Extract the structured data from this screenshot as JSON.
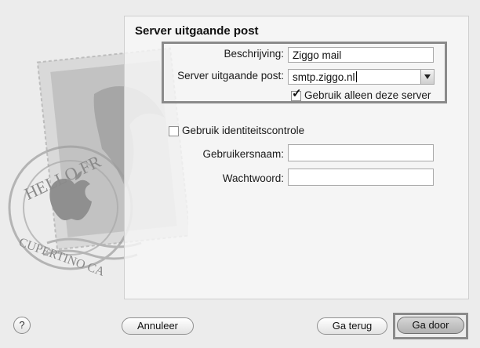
{
  "title": "Server uitgaande post",
  "fields": {
    "beschrijving": {
      "label": "Beschrijving:",
      "value": "Ziggo mail"
    },
    "server": {
      "label": "Server uitgaande post:",
      "value": "smtp.ziggo.nl"
    },
    "gebruikersnaam": {
      "label": "Gebruikersnaam:",
      "value": ""
    },
    "wachtwoord": {
      "label": "Wachtwoord:",
      "value": ""
    }
  },
  "checkboxes": {
    "only_this_server": {
      "label": "Gebruik alleen deze server",
      "checked": true
    },
    "authentication": {
      "label": "Gebruik identiteitscontrole",
      "checked": false
    }
  },
  "buttons": {
    "help": "?",
    "cancel": "Annuleer",
    "back": "Ga terug",
    "next": "Ga door"
  },
  "stamp": {
    "text_top": "HELLO FR",
    "text_bottom": "CUPERTINO CA"
  }
}
